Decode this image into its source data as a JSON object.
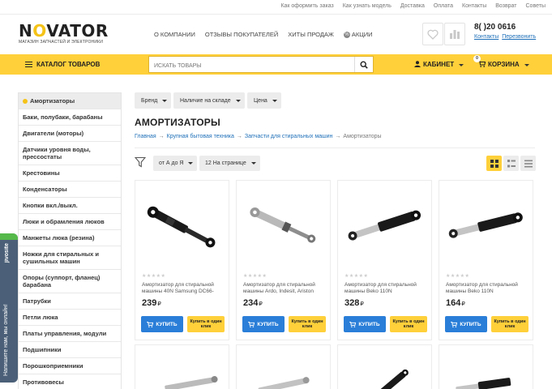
{
  "top_links": [
    "Как оформить заказ",
    "Как узнать модель",
    "Доставка",
    "Оплата",
    "Контакты",
    "Возврат",
    "Советы"
  ],
  "logo": {
    "name": "NOVATOR",
    "tagline": "МАГАЗИН ЗАПЧАСТЕЙ И ЭЛЕКТРОНИКИ"
  },
  "header_nav": [
    "О КОМПАНИИ",
    "ОТЗЫВЫ ПОКУПАТЕЛЕЙ",
    "ХИТЫ ПРОДАЖ",
    "АКЦИИ"
  ],
  "phone": {
    "number": "8(     )20   0616",
    "contacts_link": "Контакты",
    "callback_link": "Перезвонить"
  },
  "yellow_bar": {
    "catalog": "КАТАЛОГ ТОВАРОВ",
    "search_placeholder": "ИСКАТЬ ТОВАРЫ",
    "cabinet": "КАБИНЕТ",
    "cart": "КОРЗИНА",
    "cart_count": "0"
  },
  "sidebar": {
    "items": [
      "Амортизаторы",
      "Баки, полубаки, барабаны",
      "Двигатели (моторы)",
      "Датчики уровня воды, прессостаты",
      "Крестовины",
      "Конденсаторы",
      "Кнопки вкл./выкл.",
      "Люки и обрамления люков",
      "Манжеты люка (резина)",
      "Ножки для стиральных и сушильных машин",
      "Опоры (суппорт, фланец) барабана",
      "Патрубки",
      "Петли люка",
      "Платы управления, модули",
      "Подшипники",
      "Порошкоприемники",
      "Противовесы"
    ]
  },
  "filters": [
    "Бренд",
    "Наличие на складе",
    "Цена"
  ],
  "page_title": "АМОРТИЗАТОРЫ",
  "breadcrumb": {
    "items": [
      "Главная",
      "Крупная бытовая техника",
      "Запчасти для стиральных машин"
    ],
    "current": "Амортизаторы",
    "sep": "→"
  },
  "sort": {
    "order": "от А до Я",
    "per_page": "12 На странице"
  },
  "products": [
    {
      "name": "Амортизатор для стиральной машины 40N Samsung DC66-",
      "price": "239",
      "currency": "₽",
      "style": "black",
      "rating": "★★★★★"
    },
    {
      "name": "Амортизатор для стиральной машины Ardo, Indesit, Ariston",
      "price": "234",
      "currency": "₽",
      "style": "gray",
      "rating": "★★★★★"
    },
    {
      "name": "Амортизатор для стиральной машины Beko 110N",
      "price": "328",
      "currency": "₽",
      "style": "black-silver",
      "rating": "★★★★★"
    },
    {
      "name": "Амортизатор для стиральной машины Beko 110N",
      "price": "164",
      "currency": "₽",
      "style": "black-silver",
      "rating": "★★★★★"
    }
  ],
  "buy_label": "КУПИТЬ",
  "one_click_label": "Купить в один клик",
  "jivo_label": "Напишите нам, мы онлайн!",
  "jivo_brand": "jivosite",
  "colors": {
    "accent": "#ffd03a",
    "primary_button": "#2a7ed8",
    "link": "#1d6fb8"
  }
}
